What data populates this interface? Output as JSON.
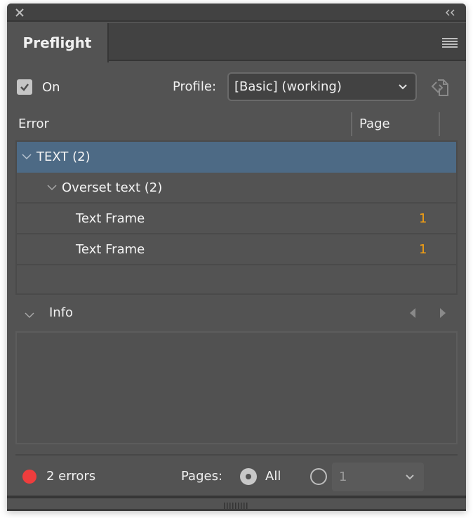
{
  "window": {
    "close_icon": "close-icon",
    "collapse_icon": "double-chevron-left-icon"
  },
  "tabs": [
    {
      "label": "Preflight",
      "active": true
    }
  ],
  "panel_menu_icon": "hamburger-menu-icon",
  "controls": {
    "on_label": "On",
    "on_checked": true,
    "profile_label": "Profile:",
    "profile_value": "[Basic] (working)",
    "profile_icon": "define-profiles-icon"
  },
  "columns": {
    "error": "Error",
    "page": "Page"
  },
  "errors": [
    {
      "label": "TEXT (2)",
      "level": 0,
      "expanded": true,
      "selected": true,
      "page": ""
    },
    {
      "label": "Overset text (2)",
      "level": 1,
      "expanded": true,
      "selected": false,
      "page": ""
    },
    {
      "label": "Text Frame",
      "level": 2,
      "selected": false,
      "page": "1"
    },
    {
      "label": "Text Frame",
      "level": 2,
      "selected": false,
      "page": "1"
    }
  ],
  "info": {
    "label": "Info",
    "expanded": true
  },
  "footer": {
    "status_color": "#ef3d3d",
    "error_count": "2 errors",
    "pages_label": "Pages:",
    "all_label": "All",
    "all_selected": true,
    "range_value": "1"
  },
  "colors": {
    "panel_bg": "#535353",
    "selection": "#4d6a85",
    "page_number": "#f5a012"
  }
}
